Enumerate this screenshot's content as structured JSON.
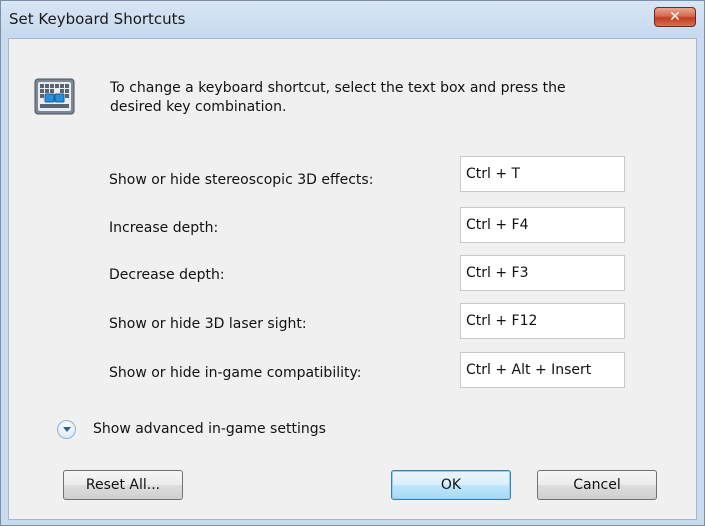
{
  "window": {
    "title": "Set Keyboard Shortcuts",
    "close_label": "✕"
  },
  "instructions": "To change a keyboard shortcut, select the text box and press the desired key combination.",
  "shortcuts": [
    {
      "label": "Show or hide stereoscopic 3D effects:",
      "value": "Ctrl + T"
    },
    {
      "label": "Increase depth:",
      "value": "Ctrl + F4"
    },
    {
      "label": "Decrease depth:",
      "value": "Ctrl + F3"
    },
    {
      "label": "Show or hide 3D laser sight:",
      "value": "Ctrl + F12"
    },
    {
      "label": "Show or hide in-game compatibility:",
      "value": "Ctrl + Alt + Insert"
    }
  ],
  "advanced": {
    "label": "Show advanced in-game settings",
    "icon": "chevron-down-icon"
  },
  "buttons": {
    "reset": "Reset All...",
    "ok": "OK",
    "cancel": "Cancel"
  },
  "colors": {
    "accent": "#3c7fb1",
    "close": "#c03e24"
  }
}
